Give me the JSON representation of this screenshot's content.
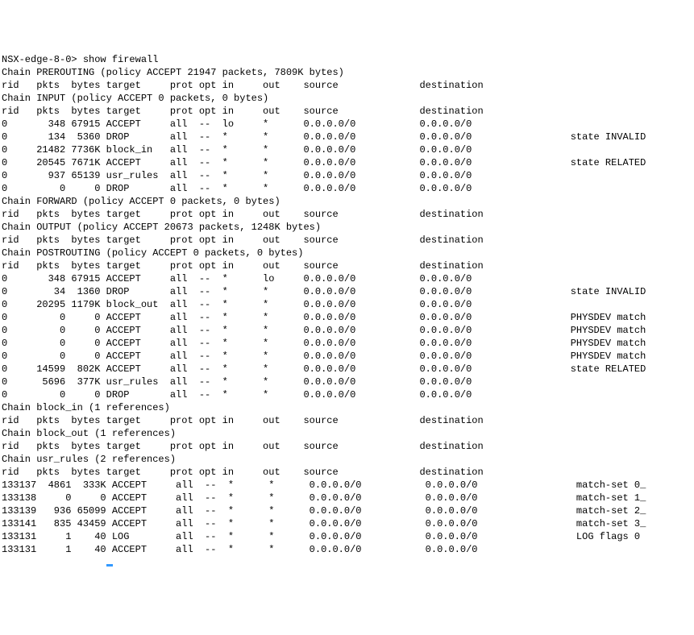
{
  "prompt_line": "NSX-edge-8-0> show firewall",
  "chains": [
    {
      "name": "PREROUTING",
      "policy": "ACCEPT",
      "pkts": "21947",
      "bytes": "7809K",
      "header_cols": [
        "rid",
        "pkts",
        "bytes",
        "target",
        "prot",
        "opt",
        "in",
        "out",
        "source",
        "destination"
      ],
      "rows": []
    },
    {
      "name": "INPUT",
      "policy": "ACCEPT",
      "pkts": "0",
      "bytes": "0",
      "header_cols": [
        "rid",
        "pkts",
        "bytes",
        "target",
        "prot",
        "opt",
        "in",
        "out",
        "source",
        "destination"
      ],
      "rows": [
        {
          "rid": "0",
          "pkts": "348",
          "bytes": "67915",
          "target": "ACCEPT",
          "prot": "all",
          "opt": "--",
          "in": "lo",
          "out": "*",
          "source": "0.0.0.0/0",
          "destination": "0.0.0.0/0",
          "extra": ""
        },
        {
          "rid": "0",
          "pkts": "134",
          "bytes": "5360",
          "target": "DROP",
          "prot": "all",
          "opt": "--",
          "in": "*",
          "out": "*",
          "source": "0.0.0.0/0",
          "destination": "0.0.0.0/0",
          "extra": "state INVALID"
        },
        {
          "rid": "0",
          "pkts": "21482",
          "bytes": "7736K",
          "target": "block_in",
          "prot": "all",
          "opt": "--",
          "in": "*",
          "out": "*",
          "source": "0.0.0.0/0",
          "destination": "0.0.0.0/0",
          "extra": ""
        },
        {
          "rid": "0",
          "pkts": "20545",
          "bytes": "7671K",
          "target": "ACCEPT",
          "prot": "all",
          "opt": "--",
          "in": "*",
          "out": "*",
          "source": "0.0.0.0/0",
          "destination": "0.0.0.0/0",
          "extra": "state RELATED"
        },
        {
          "rid": "0",
          "pkts": "937",
          "bytes": "65139",
          "target": "usr_rules",
          "prot": "all",
          "opt": "--",
          "in": "*",
          "out": "*",
          "source": "0.0.0.0/0",
          "destination": "0.0.0.0/0",
          "extra": ""
        },
        {
          "rid": "0",
          "pkts": "0",
          "bytes": "0",
          "target": "DROP",
          "prot": "all",
          "opt": "--",
          "in": "*",
          "out": "*",
          "source": "0.0.0.0/0",
          "destination": "0.0.0.0/0",
          "extra": ""
        }
      ]
    },
    {
      "name": "FORWARD",
      "policy": "ACCEPT",
      "pkts": "0",
      "bytes": "0",
      "header_cols": [
        "rid",
        "pkts",
        "bytes",
        "target",
        "prot",
        "opt",
        "in",
        "out",
        "source",
        "destination"
      ],
      "rows": []
    },
    {
      "name": "OUTPUT",
      "policy": "ACCEPT",
      "pkts": "20673",
      "bytes": "1248K",
      "header_cols": [
        "rid",
        "pkts",
        "bytes",
        "target",
        "prot",
        "opt",
        "in",
        "out",
        "source",
        "destination"
      ],
      "rows": []
    },
    {
      "name": "POSTROUTING",
      "policy": "ACCEPT",
      "pkts": "0",
      "bytes": "0",
      "header_cols": [
        "rid",
        "pkts",
        "bytes",
        "target",
        "prot",
        "opt",
        "in",
        "out",
        "source",
        "destination"
      ],
      "rows": [
        {
          "rid": "0",
          "pkts": "348",
          "bytes": "67915",
          "target": "ACCEPT",
          "prot": "all",
          "opt": "--",
          "in": "*",
          "out": "lo",
          "source": "0.0.0.0/0",
          "destination": "0.0.0.0/0",
          "extra": ""
        },
        {
          "rid": "0",
          "pkts": "34",
          "bytes": "1360",
          "target": "DROP",
          "prot": "all",
          "opt": "--",
          "in": "*",
          "out": "*",
          "source": "0.0.0.0/0",
          "destination": "0.0.0.0/0",
          "extra": "state INVALID"
        },
        {
          "rid": "0",
          "pkts": "20295",
          "bytes": "1179K",
          "target": "block_out",
          "prot": "all",
          "opt": "--",
          "in": "*",
          "out": "*",
          "source": "0.0.0.0/0",
          "destination": "0.0.0.0/0",
          "extra": ""
        },
        {
          "rid": "0",
          "pkts": "0",
          "bytes": "0",
          "target": "ACCEPT",
          "prot": "all",
          "opt": "--",
          "in": "*",
          "out": "*",
          "source": "0.0.0.0/0",
          "destination": "0.0.0.0/0",
          "extra": "PHYSDEV match"
        },
        {
          "rid": "0",
          "pkts": "0",
          "bytes": "0",
          "target": "ACCEPT",
          "prot": "all",
          "opt": "--",
          "in": "*",
          "out": "*",
          "source": "0.0.0.0/0",
          "destination": "0.0.0.0/0",
          "extra": "PHYSDEV match"
        },
        {
          "rid": "0",
          "pkts": "0",
          "bytes": "0",
          "target": "ACCEPT",
          "prot": "all",
          "opt": "--",
          "in": "*",
          "out": "*",
          "source": "0.0.0.0/0",
          "destination": "0.0.0.0/0",
          "extra": "PHYSDEV match"
        },
        {
          "rid": "0",
          "pkts": "0",
          "bytes": "0",
          "target": "ACCEPT",
          "prot": "all",
          "opt": "--",
          "in": "*",
          "out": "*",
          "source": "0.0.0.0/0",
          "destination": "0.0.0.0/0",
          "extra": "PHYSDEV match"
        },
        {
          "rid": "0",
          "pkts": "14599",
          "bytes": "802K",
          "target": "ACCEPT",
          "prot": "all",
          "opt": "--",
          "in": "*",
          "out": "*",
          "source": "0.0.0.0/0",
          "destination": "0.0.0.0/0",
          "extra": "state RELATED"
        },
        {
          "rid": "0",
          "pkts": "5696",
          "bytes": "377K",
          "target": "usr_rules",
          "prot": "all",
          "opt": "--",
          "in": "*",
          "out": "*",
          "source": "0.0.0.0/0",
          "destination": "0.0.0.0/0",
          "extra": ""
        },
        {
          "rid": "0",
          "pkts": "0",
          "bytes": "0",
          "target": "DROP",
          "prot": "all",
          "opt": "--",
          "in": "*",
          "out": "*",
          "source": "0.0.0.0/0",
          "destination": "0.0.0.0/0",
          "extra": ""
        }
      ]
    }
  ],
  "custom_chains": [
    {
      "name": "block_in",
      "refs": "1",
      "header_cols": [
        "rid",
        "pkts",
        "bytes",
        "target",
        "prot",
        "opt",
        "in",
        "out",
        "source",
        "destination"
      ],
      "rows": []
    },
    {
      "name": "block_out",
      "refs": "1",
      "header_cols": [
        "rid",
        "pkts",
        "bytes",
        "target",
        "prot",
        "opt",
        "in",
        "out",
        "source",
        "destination"
      ],
      "rows": []
    },
    {
      "name": "usr_rules",
      "refs": "2",
      "header_cols": [
        "rid",
        "pkts",
        "bytes",
        "target",
        "prot",
        "opt",
        "in",
        "out",
        "source",
        "destination"
      ],
      "rows": [
        {
          "rid": "133137",
          "pkts": "4861",
          "bytes": "333K",
          "target": "ACCEPT",
          "prot": "all",
          "opt": "--",
          "in": "*",
          "out": "*",
          "source": "0.0.0.0/0",
          "destination": "0.0.0.0/0",
          "extra": "match-set 0_"
        },
        {
          "rid": "133138",
          "pkts": "0",
          "bytes": "0",
          "target": "ACCEPT",
          "prot": "all",
          "opt": "--",
          "in": "*",
          "out": "*",
          "source": "0.0.0.0/0",
          "destination": "0.0.0.0/0",
          "extra": "match-set 1_"
        },
        {
          "rid": "133139",
          "pkts": "936",
          "bytes": "65099",
          "target": "ACCEPT",
          "prot": "all",
          "opt": "--",
          "in": "*",
          "out": "*",
          "source": "0.0.0.0/0",
          "destination": "0.0.0.0/0",
          "extra": "match-set 2_"
        },
        {
          "rid": "133141",
          "pkts": "835",
          "bytes": "43459",
          "target": "ACCEPT",
          "prot": "all",
          "opt": "--",
          "in": "*",
          "out": "*",
          "source": "0.0.0.0/0",
          "destination": "0.0.0.0/0",
          "extra": "match-set 3_"
        },
        {
          "rid": "133131",
          "pkts": "1",
          "bytes": "40",
          "target": "LOG",
          "prot": "all",
          "opt": "--",
          "in": "*",
          "out": "*",
          "source": "0.0.0.0/0",
          "destination": "0.0.0.0/0",
          "extra": "LOG flags 0"
        },
        {
          "rid": "133131",
          "pkts": "1",
          "bytes": "40",
          "target": "ACCEPT",
          "prot": "all",
          "opt": "--",
          "in": "*",
          "out": "*",
          "source": "0.0.0.0/0",
          "destination": "0.0.0.0/0",
          "extra": ""
        }
      ]
    }
  ],
  "col_widths": {
    "rid": 6,
    "pkts": 6,
    "bytes": 6,
    "target": 11,
    "prot": 5,
    "opt": 4,
    "in": 7,
    "out": 7,
    "source": 20,
    "destination": 26,
    "extra": 0
  }
}
